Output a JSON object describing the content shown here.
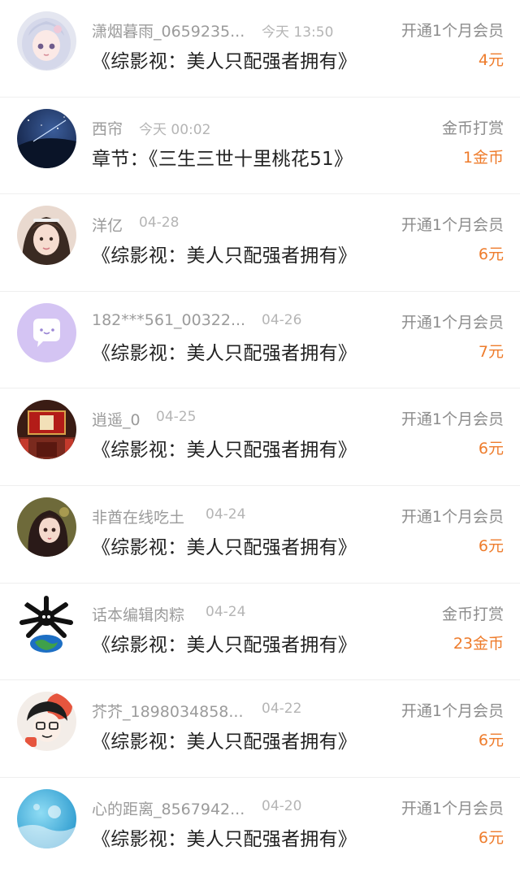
{
  "colors": {
    "amount": "#ee7c2c",
    "name": "#9b9b9b",
    "time": "#b5b5b5",
    "title": "#222222"
  },
  "records": [
    {
      "name": "潇烟暮雨_0659235...",
      "time": "今天 13:50",
      "title": "《综影视：美人只配强者拥有》",
      "type": "开通1个月会员",
      "amount": "4元",
      "avatar_icon": "anime-girl-avatar-icon"
    },
    {
      "name": "西帘",
      "time": "今天 00:02",
      "title": "章节：《三生三世十里桃花51》",
      "type": "金币打赏",
      "amount": "1金币",
      "avatar_icon": "night-sky-avatar-icon"
    },
    {
      "name": "洋亿",
      "time": "04-28",
      "title": "《综影视：美人只配强者拥有》",
      "type": "开通1个月会员",
      "amount": "6元",
      "avatar_icon": "girl-photo-avatar-icon"
    },
    {
      "name": "182***561_00322...",
      "time": "04-26",
      "title": "《综影视：美人只配强者拥有》",
      "type": "开通1个月会员",
      "amount": "7元",
      "avatar_icon": "default-chat-avatar-icon"
    },
    {
      "name": "逍遥_0",
      "time": "04-25",
      "title": "《综影视：美人只配强者拥有》",
      "type": "开通1个月会员",
      "amount": "6元",
      "avatar_icon": "temple-sign-avatar-icon"
    },
    {
      "name": "非酋在线吃土",
      "time": "04-24",
      "title": "《综影视：美人只配强者拥有》",
      "type": "开通1个月会员",
      "amount": "6元",
      "avatar_icon": "doll-avatar-icon"
    },
    {
      "name": "话本编辑肉粽",
      "time": "04-24",
      "title": "《综影视：美人只配强者拥有》",
      "type": "金币打赏",
      "amount": "23金币",
      "avatar_icon": "skull-earth-avatar-icon"
    },
    {
      "name": "芥芥_1898034858...",
      "time": "04-22",
      "title": "《综影视：美人只配强者拥有》",
      "type": "开通1个月会员",
      "amount": "6元",
      "avatar_icon": "cartoon-boy-avatar-icon"
    },
    {
      "name": "心的距离_8567942...",
      "time": "04-20",
      "title": "《综影视：美人只配强者拥有》",
      "type": "开通1个月会员",
      "amount": "6元",
      "avatar_icon": "water-drop-avatar-icon"
    }
  ]
}
